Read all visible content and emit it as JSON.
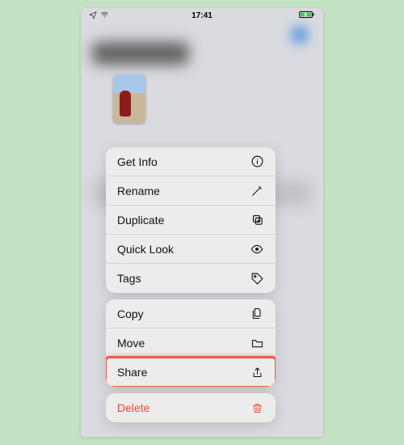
{
  "status": {
    "airplane": "airplane-icon",
    "wifi": "wifi-icon",
    "time": "17:41",
    "battery": "battery-charging-icon"
  },
  "background": {
    "title": "Recents"
  },
  "thumbnail": {
    "desc": "selected-video-thumbnail"
  },
  "menu": {
    "groups": [
      {
        "items": [
          {
            "label": "Get Info",
            "icon": "info-circle-icon"
          },
          {
            "label": "Rename",
            "icon": "pencil-icon"
          },
          {
            "label": "Duplicate",
            "icon": "duplicate-icon"
          },
          {
            "label": "Quick Look",
            "icon": "eye-icon"
          },
          {
            "label": "Tags",
            "icon": "tag-icon"
          }
        ]
      },
      {
        "items": [
          {
            "label": "Copy",
            "icon": "documents-icon"
          },
          {
            "label": "Move",
            "icon": "folder-icon"
          },
          {
            "label": "Share",
            "icon": "share-icon",
            "highlighted": true
          }
        ]
      },
      {
        "items": [
          {
            "label": "Delete",
            "icon": "trash-icon",
            "danger": true
          }
        ]
      }
    ]
  }
}
